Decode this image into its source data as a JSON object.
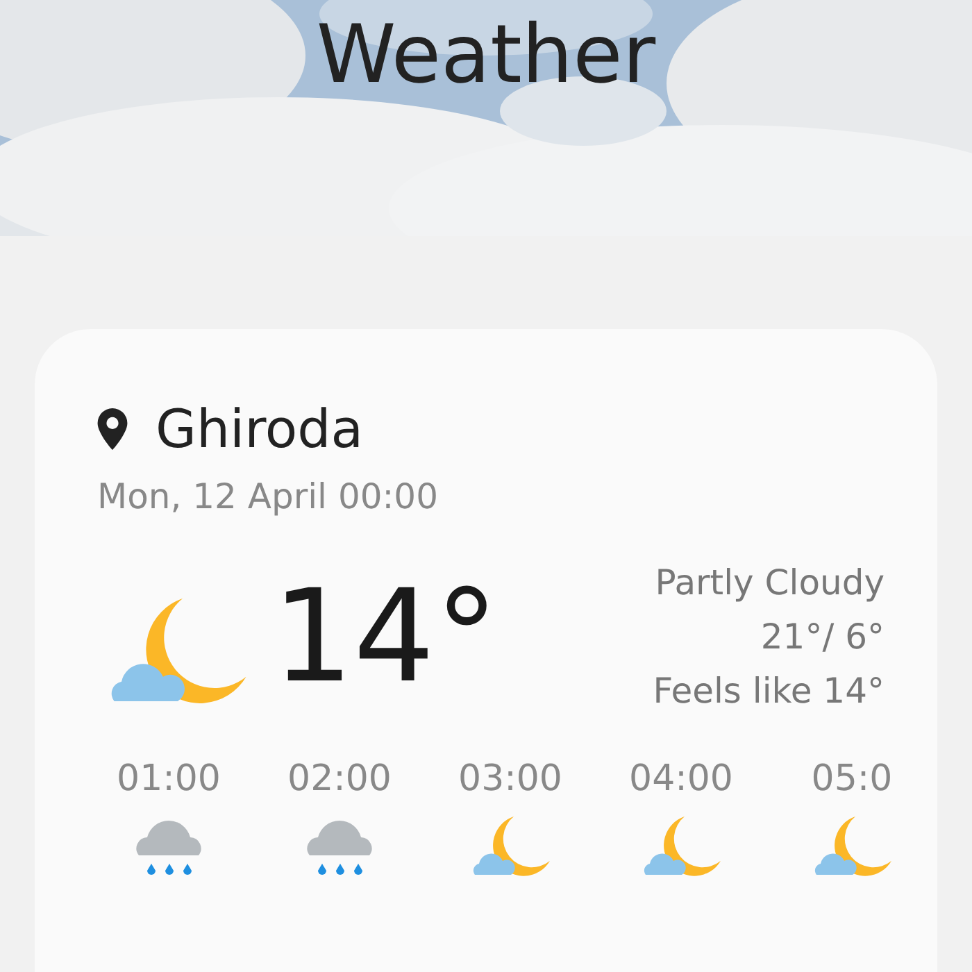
{
  "header": {
    "title": "Weather"
  },
  "current": {
    "location": "Ghiroda",
    "datetime": "Mon, 12 April 00:00",
    "kind": "night-cloud",
    "temperature": "14°",
    "condition": "Partly Cloudy",
    "high_low": "21°/ 6°",
    "feels_like": "Feels like 14°"
  },
  "hourly": [
    {
      "time": "01:00",
      "kind": "rain"
    },
    {
      "time": "02:00",
      "kind": "rain"
    },
    {
      "time": "03:00",
      "kind": "night-cloud"
    },
    {
      "time": "04:00",
      "kind": "night-cloud"
    },
    {
      "time": "05:0",
      "kind": "night-cloud"
    }
  ]
}
